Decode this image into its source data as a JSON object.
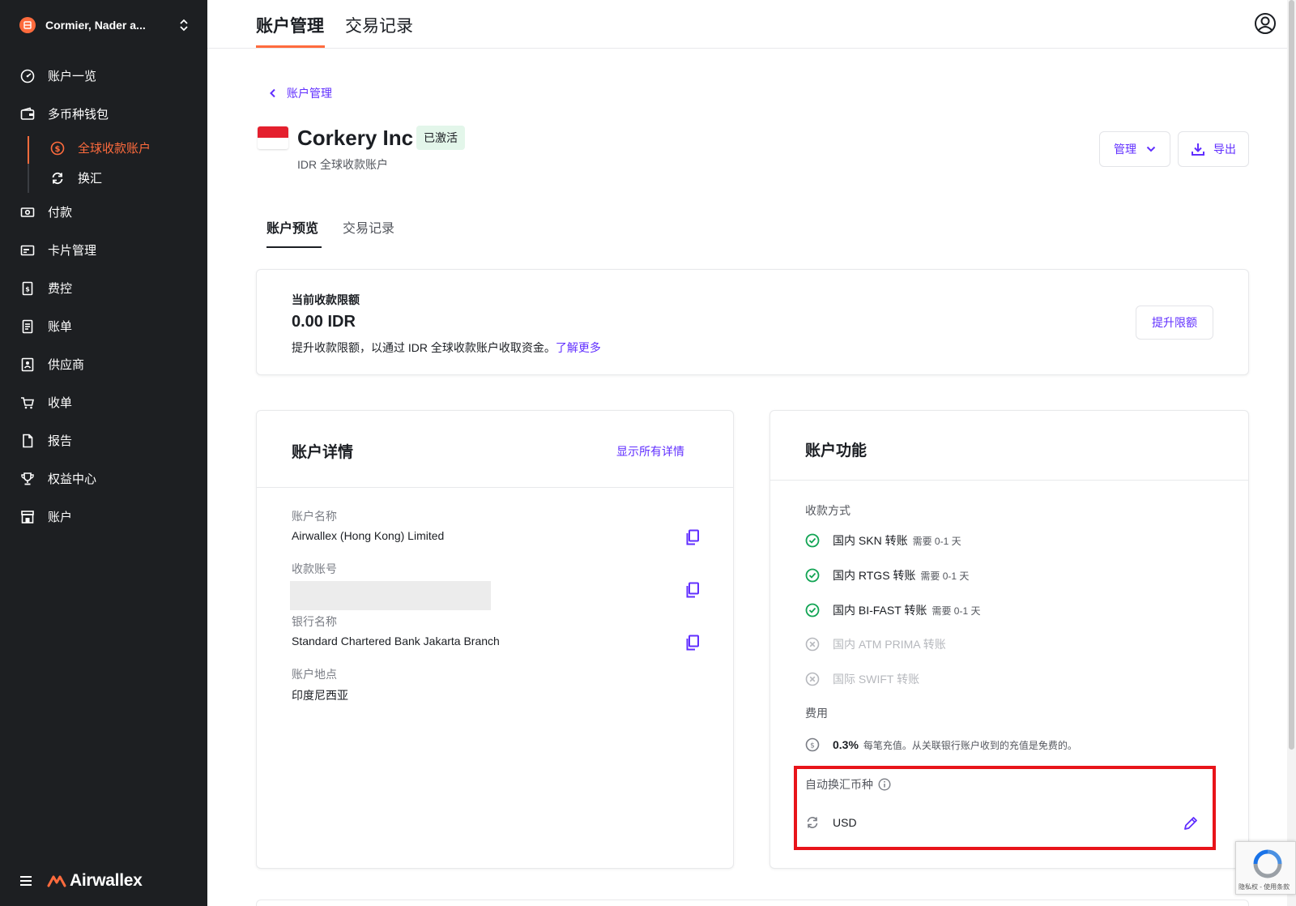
{
  "sidebar": {
    "org_name": "Cormier, Nader a...",
    "items": [
      {
        "label": "账户一览",
        "icon": "dashboard-icon"
      },
      {
        "label": "多币种钱包",
        "icon": "wallet-icon"
      },
      {
        "label": "付款",
        "icon": "payment-icon"
      },
      {
        "label": "卡片管理",
        "icon": "card-icon"
      },
      {
        "label": "费控",
        "icon": "expense-icon"
      },
      {
        "label": "账单",
        "icon": "bill-icon"
      },
      {
        "label": "供应商",
        "icon": "vendor-icon"
      },
      {
        "label": "收单",
        "icon": "cart-icon"
      },
      {
        "label": "报告",
        "icon": "report-icon"
      },
      {
        "label": "权益中心",
        "icon": "trophy-icon"
      },
      {
        "label": "账户",
        "icon": "store-icon"
      }
    ],
    "subitems": [
      {
        "label": "全球收款账户",
        "icon": "dollar-circle-icon",
        "active": true
      },
      {
        "label": "换汇",
        "icon": "exchange-icon",
        "active": false
      }
    ],
    "brand": "Airwallex",
    "accent_color": "#ff6b3d"
  },
  "header": {
    "tabs": [
      "账户管理",
      "交易记录"
    ],
    "active_tab": "账户管理"
  },
  "main": {
    "back_label": "账户管理",
    "account_title": "Corkery Inc",
    "status_badge": "已激活",
    "account_subtitle": "IDR 全球收款账户",
    "manage_button": "管理",
    "export_button": "导出",
    "subtabs": [
      "账户预览",
      "交易记录"
    ],
    "limit": {
      "label": "当前收款限额",
      "value": "0.00 IDR",
      "description": "提升收款限额，以通过 IDR 全球收款账户收取资金。",
      "learn_more": "了解更多",
      "button": "提升限额"
    },
    "details": {
      "title": "账户详情",
      "show_all": "显示所有详情",
      "fields": [
        {
          "label": "账户名称",
          "value": "Airwallex (Hong Kong) Limited"
        },
        {
          "label": "收款账号",
          "value": ""
        },
        {
          "label": "银行名称",
          "value": "Standard Chartered Bank Jakarta Branch"
        },
        {
          "label": "账户地点",
          "value": "印度尼西亚"
        }
      ]
    },
    "features": {
      "title": "账户功能",
      "methods_label": "收款方式",
      "methods": [
        {
          "name": "国内 SKN 转账",
          "note": "需要 0-1 天",
          "enabled": true
        },
        {
          "name": "国内 RTGS 转账",
          "note": "需要 0-1 天",
          "enabled": true
        },
        {
          "name": "国内 BI-FAST 转账",
          "note": "需要 0-1 天",
          "enabled": true
        },
        {
          "name": "国内 ATM PRIMA 转账",
          "note": "",
          "enabled": false
        },
        {
          "name": "国际 SWIFT 转账",
          "note": "",
          "enabled": false
        }
      ],
      "fee_label": "费用",
      "fee_pct": "0.3%",
      "fee_note": "每笔充值。从关联银行账户收到的充值是免费的。",
      "auto_convert_label": "自动换汇币种",
      "auto_convert_value": "USD"
    }
  },
  "recaptcha_text": "隐私权 - 使用条款",
  "colors": {
    "link": "#612fff",
    "success": "#12a454",
    "highlight": "#e8141a"
  }
}
